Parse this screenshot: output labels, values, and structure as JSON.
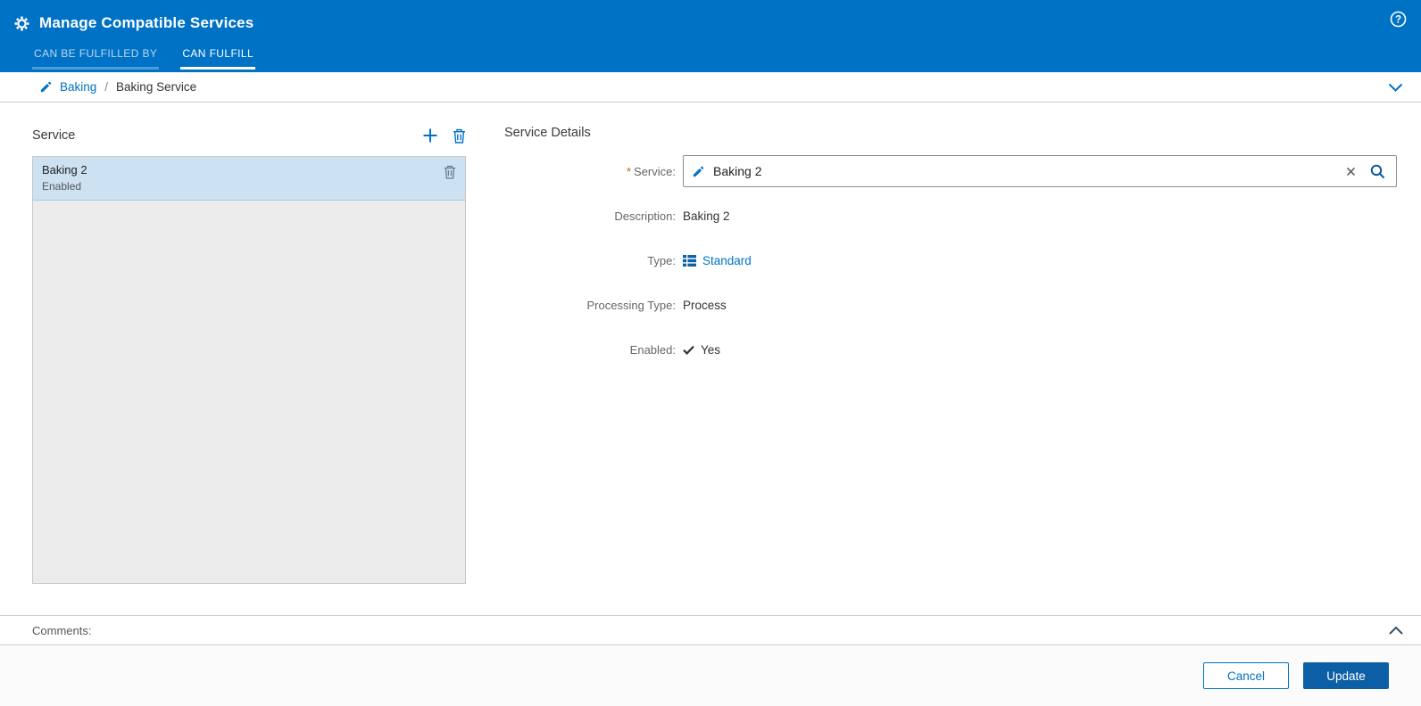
{
  "colors": {
    "header_blue": "#0072C6",
    "primary_button_blue": "#0C5FA5",
    "selected_row_blue": "#CCE1F2",
    "link_blue": "#0072C6",
    "required_asterisk_orange": "#BF5F00",
    "list_background_gray": "#ECECEC"
  },
  "icons": [
    "gear-icon",
    "help-icon",
    "edit-pencil-icon",
    "chevron-down-icon",
    "add-icon",
    "delete-icon",
    "clear-icon",
    "search-icon",
    "grid-type-icon",
    "check-icon",
    "chevron-up-icon"
  ],
  "header": {
    "title": "Manage Compatible Services",
    "tabs": [
      {
        "label": "CAN BE FULFILLED BY",
        "active": false
      },
      {
        "label": "CAN FULFILL",
        "active": true
      }
    ]
  },
  "breadcrumb": {
    "parent": "Baking",
    "separator": "/",
    "current": "Baking Service"
  },
  "service_list": {
    "heading": "Service",
    "items": [
      {
        "name": "Baking 2",
        "status": "Enabled",
        "selected": true
      }
    ]
  },
  "details": {
    "heading": "Service Details",
    "service": {
      "label": "Service:",
      "required_mark": "*",
      "value": "Baking 2"
    },
    "description": {
      "label": "Description:",
      "value": "Baking 2"
    },
    "type": {
      "label": "Type:",
      "value": "Standard"
    },
    "processing_type": {
      "label": "Processing Type:",
      "value": "Process"
    },
    "enabled": {
      "label": "Enabled:",
      "value": "Yes"
    }
  },
  "comments": {
    "label": "Comments:"
  },
  "footer": {
    "cancel": "Cancel",
    "update": "Update"
  }
}
